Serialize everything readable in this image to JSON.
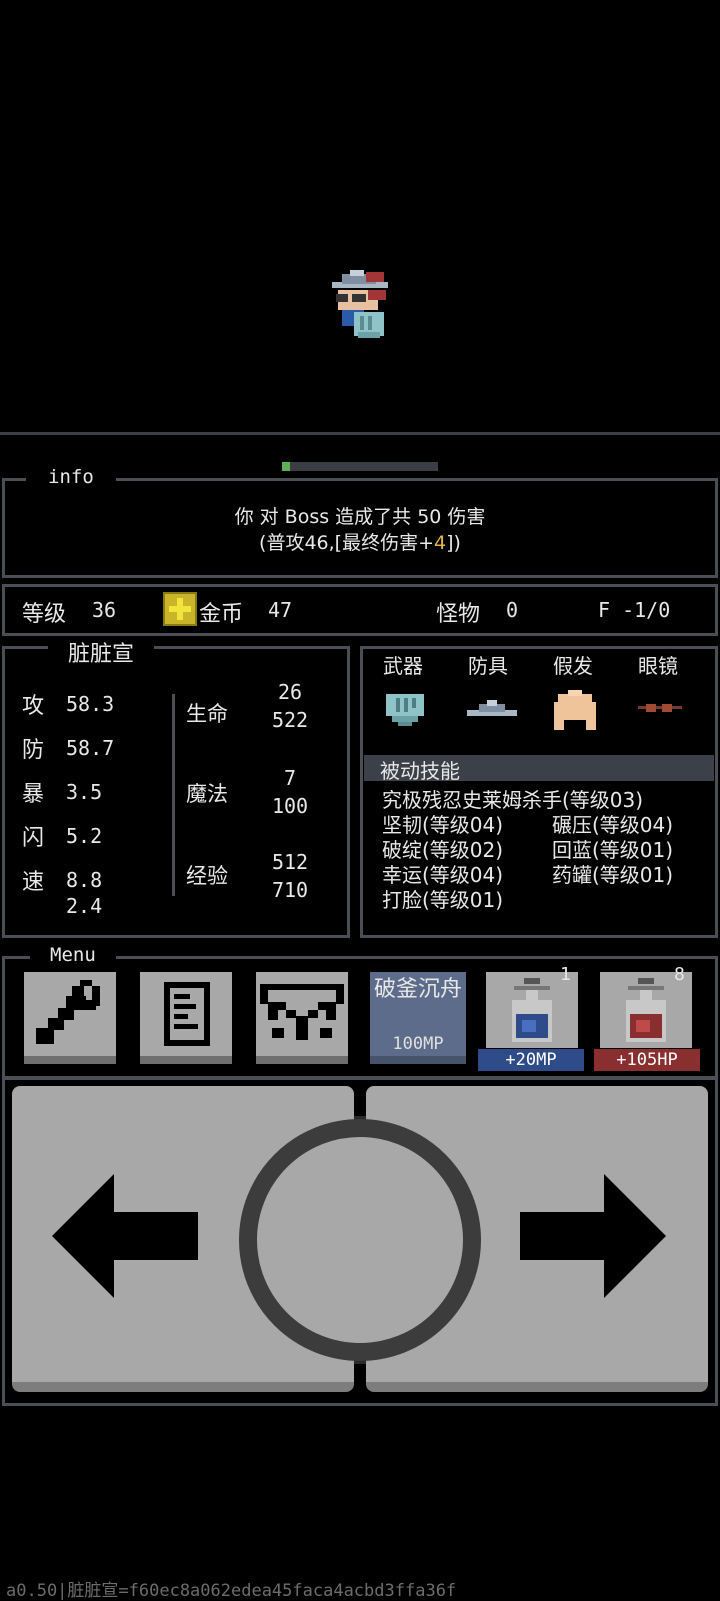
{
  "info": {
    "title": "info",
    "line1": "你 对 Boss 造成了共 50 伤害",
    "line2_pre": "(普攻46,[最终伤害+",
    "line2_num": "4",
    "line2_post": "])",
    "hp_progress": 0.05
  },
  "status": {
    "level_label": "等级",
    "level_value": "36",
    "coin_label": "金币",
    "coin_value": "47",
    "monster_label": "怪物",
    "monster_value": "0",
    "floor": "F -1/0"
  },
  "character": {
    "name": "脏脏宣",
    "stats": [
      {
        "label": "攻",
        "value": "58.3"
      },
      {
        "label": "防",
        "value": "58.7"
      },
      {
        "label": "暴",
        "value": "3.5"
      },
      {
        "label": "闪",
        "value": "5.2"
      },
      {
        "label": "速",
        "value": "8.8",
        "value2": "2.4"
      }
    ],
    "hp": {
      "label": "生命",
      "current": "26",
      "max": "522"
    },
    "mp": {
      "label": "魔法",
      "current": "7",
      "max": "100"
    },
    "exp": {
      "label": "经验",
      "current": "512",
      "max": "710"
    }
  },
  "equipment": {
    "slots": [
      {
        "label": "武器",
        "icon": "shield-weapon-icon"
      },
      {
        "label": "防具",
        "icon": "hat-armor-icon"
      },
      {
        "label": "假发",
        "icon": "wig-icon"
      },
      {
        "label": "眼镜",
        "icon": "glasses-icon"
      }
    ],
    "passive_title": "被动技能",
    "skills_full": "究极残忍史莱姆杀手(等级03)",
    "skills_rows": [
      [
        "坚韧(等级04)",
        "碾压(等级04)"
      ],
      [
        "破绽(等级02)",
        "回蓝(等级01)"
      ],
      [
        "幸运(等级04)",
        "药罐(等级01)"
      ],
      [
        "打脸(等级01)",
        ""
      ]
    ]
  },
  "menu": {
    "title": "Menu",
    "buttons": [
      "wrench-icon",
      "document-icon",
      "crossbow-icon"
    ],
    "skill_name": "破釜沉舟",
    "skill_cost": "100MP",
    "mp_potion": {
      "count": "1",
      "label": "+20MP"
    },
    "hp_potion": {
      "count": "8",
      "label": "+105HP"
    }
  },
  "controls": {
    "left": "arrow-left-icon",
    "center": "circle-action-icon",
    "right": "arrow-right-icon"
  },
  "footer": "a0.50|脏脏宣=f60ec8a062edea45faca4acbd3ffa36f",
  "colors": {
    "panel_border": "#4a4e55",
    "button_gray": "#a8a8a8",
    "skill_blue": "#5d6c8a",
    "mp_blue": "#2f4c8a",
    "hp_red": "#8a2f2f",
    "highlight": "#e0b84a"
  }
}
